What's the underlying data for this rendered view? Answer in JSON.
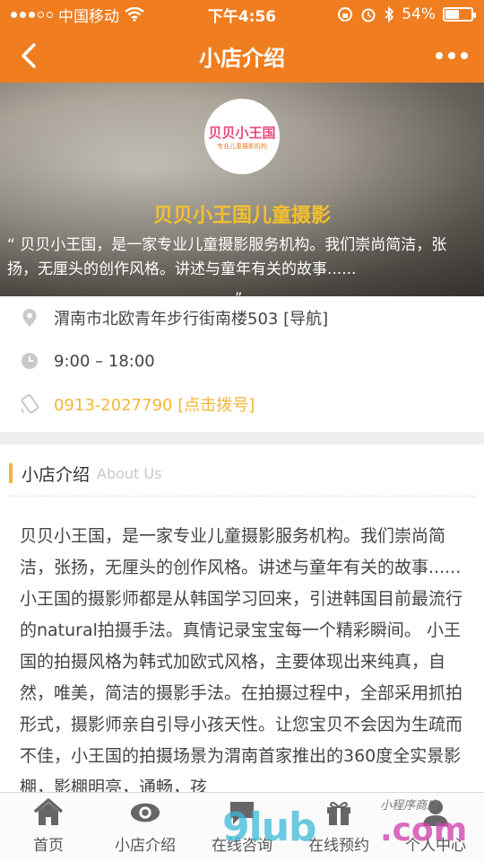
{
  "status_bar": {
    "carrier": "中国移动",
    "time": "下午4:56",
    "battery_percent": "54%",
    "battery_level": 0.54
  },
  "nav": {
    "title": "小店介绍",
    "back_icon": "chevron-left-icon",
    "more_icon": "more-dots-icon"
  },
  "hero": {
    "logo_text": "贝贝小王国",
    "logo_sub": "专业儿童摄影机构",
    "title": "贝贝小王国儿童摄影",
    "description": "“ 贝贝小王国，是一家专业儿童摄影服务机构。我们崇尚简洁，张扬，无厘头的创作风格。讲述与童年有关的故事......",
    "description_end": "”"
  },
  "info": {
    "address": "渭南市北欧青年步行街南楼503 [导航]",
    "hours": "9:00 – 18:00",
    "phone": "0913-2027790 [点击拨号]"
  },
  "about": {
    "title": "小店介绍",
    "subtitle": "About Us",
    "text": "贝贝小王国，是一家专业儿童摄影服务机构。我们崇尚简洁，张扬，无厘头的创作风格。讲述与童年有关的故事...... 小王国的摄影师都是从韩国学习回来，引进韩国目前最流行的natural拍摄手法。真情记录宝宝每一个精彩瞬间。 小王国的拍摄风格为韩式加欧式风格，主要体现出来纯真，自然，唯美，简洁的摄影手法。在拍摄过程中，全部采用抓拍形式，摄影师亲自引导小孩天性。让您宝贝不会因为生疏而不佳，小王国的拍摄场景为渭南首家推出的360度全实景影棚，影棚明亮，通畅，孩"
  },
  "tabs": [
    {
      "label": "首页",
      "icon": "home-icon"
    },
    {
      "label": "小店介绍",
      "icon": "eye-icon"
    },
    {
      "label": "在线咨询",
      "icon": "chat-icon"
    },
    {
      "label": "在线预约",
      "icon": "gift-icon"
    },
    {
      "label": "个人中心",
      "icon": "user-icon"
    }
  ],
  "watermark": {
    "main": "9lub",
    "suffix": ".com",
    "small": "小程序商店"
  },
  "colors": {
    "brand_orange": "#f07d1f",
    "accent_yellow": "#f3b63b",
    "hero_title": "#f4c02d"
  }
}
